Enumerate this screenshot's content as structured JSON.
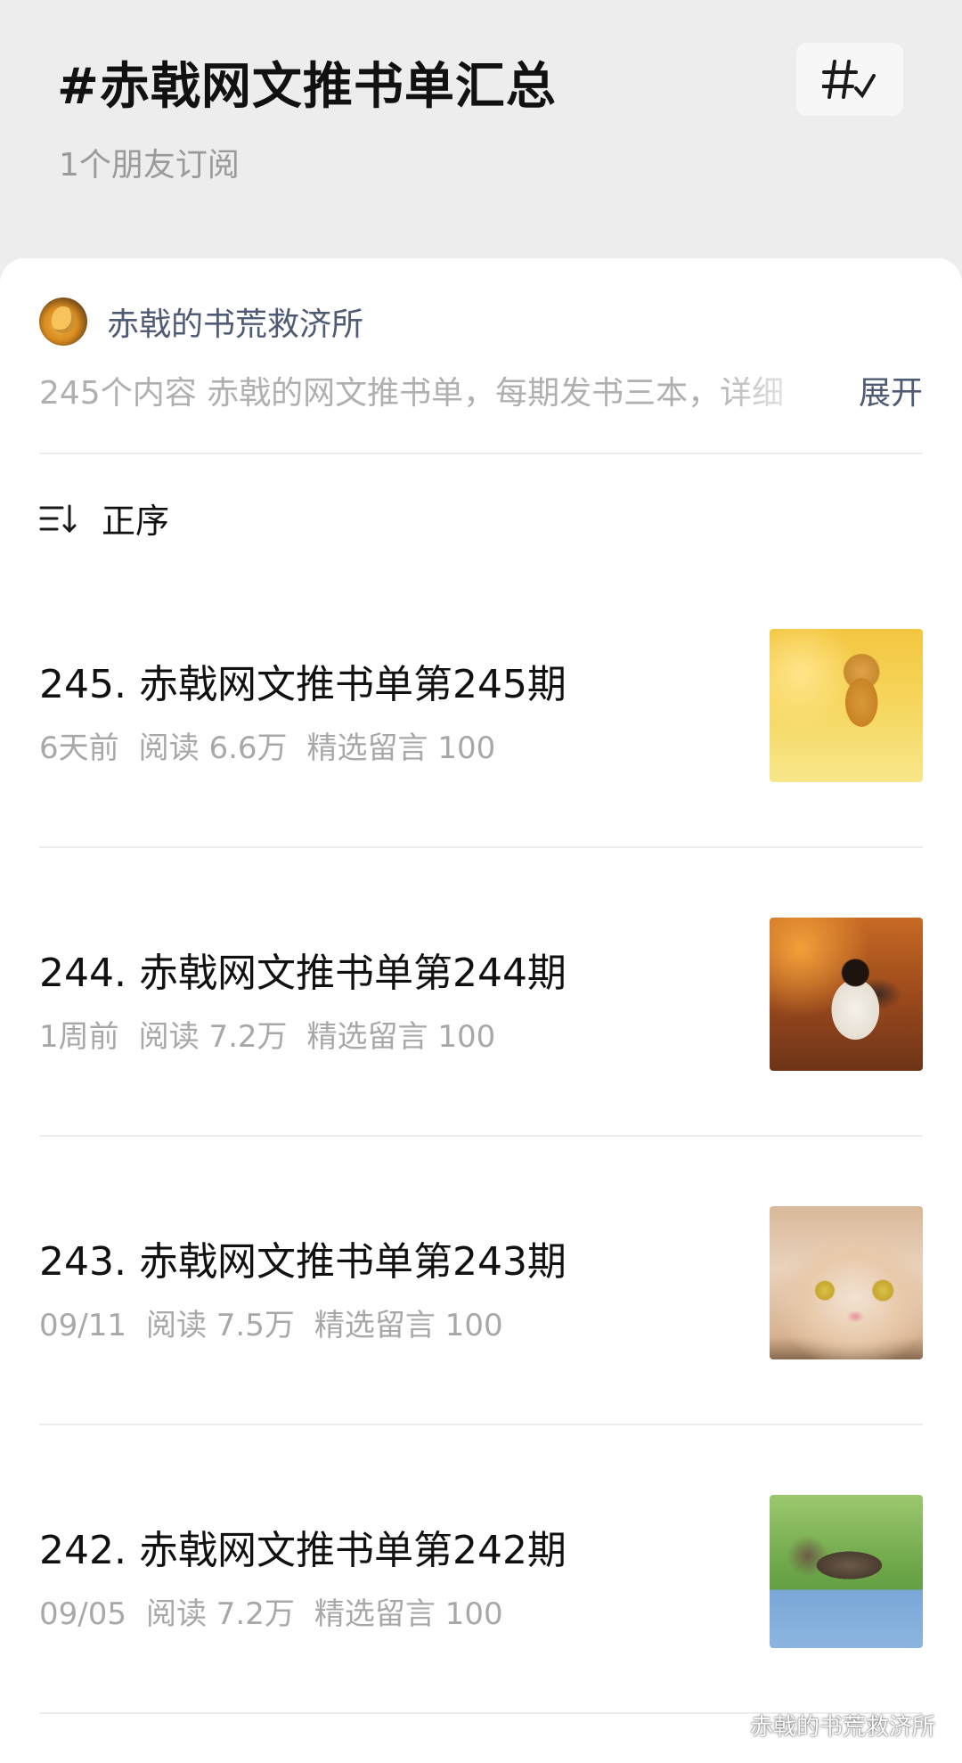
{
  "header": {
    "title": "#赤戟网文推书单汇总",
    "subscribers": "1个朋友订阅",
    "hashtag_icon": "hashtag-edit-icon"
  },
  "account": {
    "name": "赤戟的书荒救济所",
    "description": "245个内容  赤戟的网文推书单，每期发书三本，详细",
    "expand_label": "展开"
  },
  "sort": {
    "label": "正序",
    "icon": "sort-order-icon"
  },
  "articles": [
    {
      "title": "245. 赤戟网文推书单第245期",
      "date": "6天前",
      "reads": "阅读 6.6万",
      "comments": "精选留言 100"
    },
    {
      "title": "244. 赤戟网文推书单第244期",
      "date": "1周前",
      "reads": "阅读 7.2万",
      "comments": "精选留言 100"
    },
    {
      "title": "243. 赤戟网文推书单第243期",
      "date": "09/11",
      "reads": "阅读 7.5万",
      "comments": "精选留言 100"
    },
    {
      "title": "242. 赤戟网文推书单第242期",
      "date": "09/05",
      "reads": "阅读 7.2万",
      "comments": "精选留言 100"
    }
  ],
  "watermark": {
    "text": "赤戟的书荒救济所",
    "icon": "wechat-icon"
  }
}
